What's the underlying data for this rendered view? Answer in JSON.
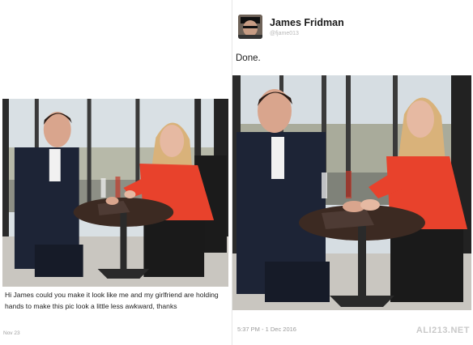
{
  "left_tweet": {
    "caption": "Hi James could you make it look like me and my girlfriend are holding hands to make this pic look a little less awkward, thanks",
    "timestamp": "Nov 23"
  },
  "right_tweet": {
    "author_name": "James Fridman",
    "author_handle": "@fjame013",
    "text": "Done.",
    "timestamp": "5:37 PM - 1 Dec 2016",
    "watermark": "ALI213.NET"
  },
  "colors": {
    "window_light": "#dfe6ea",
    "frame_dark": "#2b2b2b",
    "table": "#3c2a22",
    "suit": "#1d2436",
    "red_blouse": "#e8422c",
    "hair_blonde": "#d9b27a"
  }
}
